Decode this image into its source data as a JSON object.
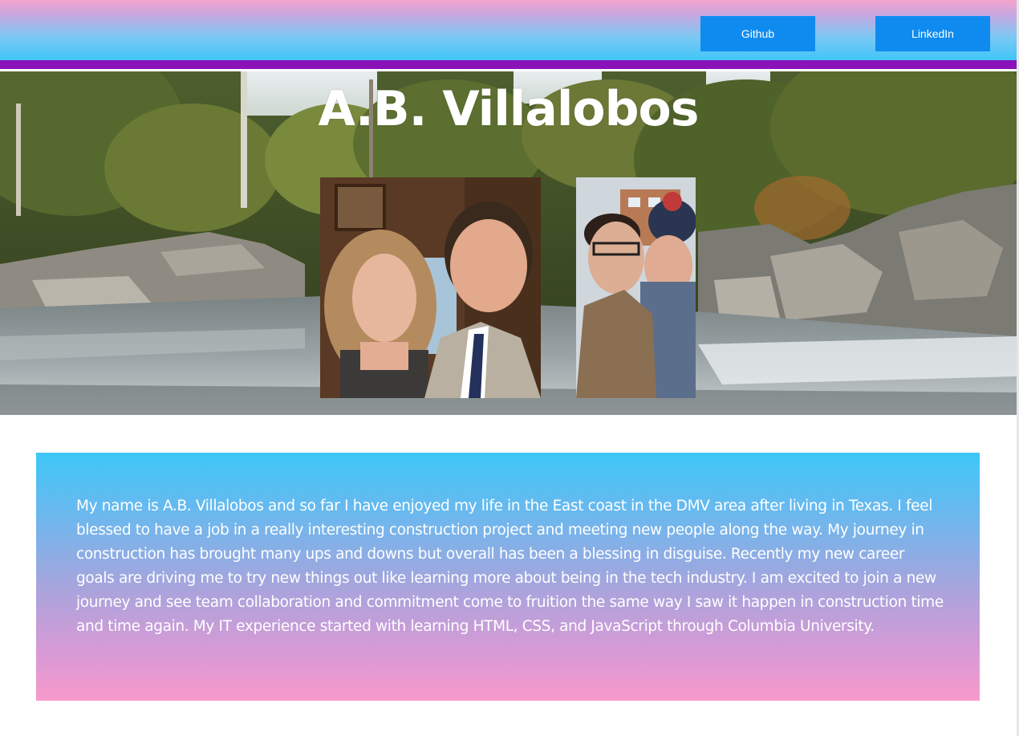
{
  "nav": {
    "github_label": "Github",
    "linkedin_label": "LinkedIn"
  },
  "hero": {
    "title": "A.B. Villalobos",
    "background": "river-forest-photo",
    "photos": [
      {
        "name": "couple-photo-formal"
      },
      {
        "name": "couple-selfie-photo"
      }
    ]
  },
  "about": {
    "text": "My name is A.B. Villalobos and so far I have enjoyed my life in the East coast in the DMV area after living in Texas. I feel blessed to have a job in a really interesting construction project and meeting new people along the way. My journey in construction has brought many ups and downs but overall has been a blessing in disguise. Recently my new career goals are driving me to try new things out like learning more about being in the tech industry. I am excited to join a new journey and see team collaboration and commitment come to fruition the same way I saw it happen in construction time and time again. My IT experience started with learning HTML, CSS, and JavaScript through Columbia University."
  },
  "colors": {
    "nav_button": "#0f8bf0",
    "rule": "#8a12b8",
    "nav_top": "#f5a3cc",
    "nav_bottom": "#3fc6f8",
    "about_top": "#3ec7f7",
    "about_bottom": "#f89acb"
  }
}
